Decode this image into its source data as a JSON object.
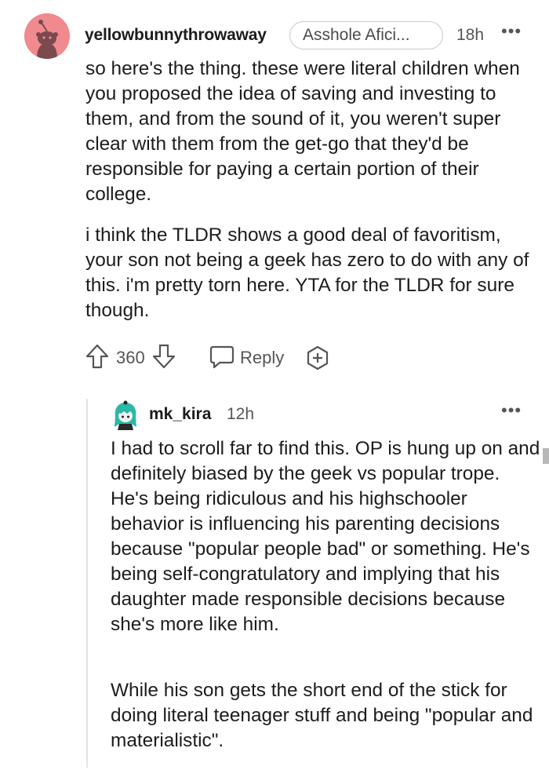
{
  "comment": {
    "username": "yellowbunnythrowaway",
    "flair": "Asshole Afici...",
    "time": "18h",
    "more": "•••",
    "paragraphs": [
      "so here's the thing. these were literal children when you proposed the idea of saving and investing to them, and from the sound of it, you weren't super clear with them from the get-go that they'd be responsible for paying a certain portion of their college.",
      "i think the TLDR shows a good deal of favoritism, your son not being a geek has zero to do with any of this. i'm pretty torn here. YTA for the TLDR for sure though."
    ],
    "score": "360",
    "reply_label": "Reply",
    "avatar_icon": "reddit-snoo-avatar",
    "avatar_color": "#f08a8f"
  },
  "reply": {
    "username": "mk_kira",
    "time": "12h",
    "more": "•••",
    "paragraphs": [
      "I had to scroll far to find this. OP is hung up on and definitely biased by the geek vs popular trope. He's being ridiculous and his highschooler behavior is influencing his parenting decisions because \"popular people bad\" or something. He's being self-congratulatory and implying that his daughter made responsible decisions because she's more like him.",
      "While his son gets the short end of the stick for doing literal teenager stuff and being \"popular and materialistic\"."
    ],
    "avatar_icon": "reddit-snoo-avatar",
    "avatar_color": "#2bb8a6"
  },
  "icons": {
    "upvote": "arrow-up-outline-icon",
    "downvote": "arrow-down-outline-icon",
    "reply": "speech-bubble-icon",
    "award": "plus-award-icon",
    "more": "more-horizontal-icon"
  }
}
